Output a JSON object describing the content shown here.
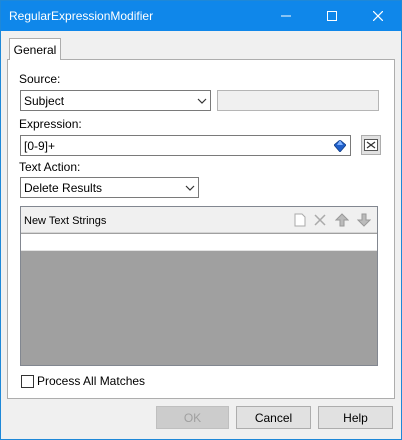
{
  "window": {
    "title": "RegularExpressionModifier"
  },
  "tabs": [
    {
      "label": "General"
    }
  ],
  "source": {
    "label": "Source:",
    "value": "Subject",
    "extra_value": ""
  },
  "expression": {
    "label": "Expression:",
    "value": "[0-9]+"
  },
  "text_action": {
    "label": "Text Action:",
    "value": "Delete Results"
  },
  "list": {
    "header": "New Text Strings",
    "tools": [
      "new-icon",
      "delete-icon",
      "move-up-icon",
      "move-down-icon"
    ],
    "rows": [
      ""
    ]
  },
  "process_all": {
    "label": "Process All Matches",
    "checked": false
  },
  "buttons": {
    "ok": "OK",
    "cancel": "Cancel",
    "help": "Help"
  },
  "colors": {
    "titlebar": "#0f87ea",
    "list_bg": "#a0a0a0",
    "accent": "#0078d7"
  }
}
